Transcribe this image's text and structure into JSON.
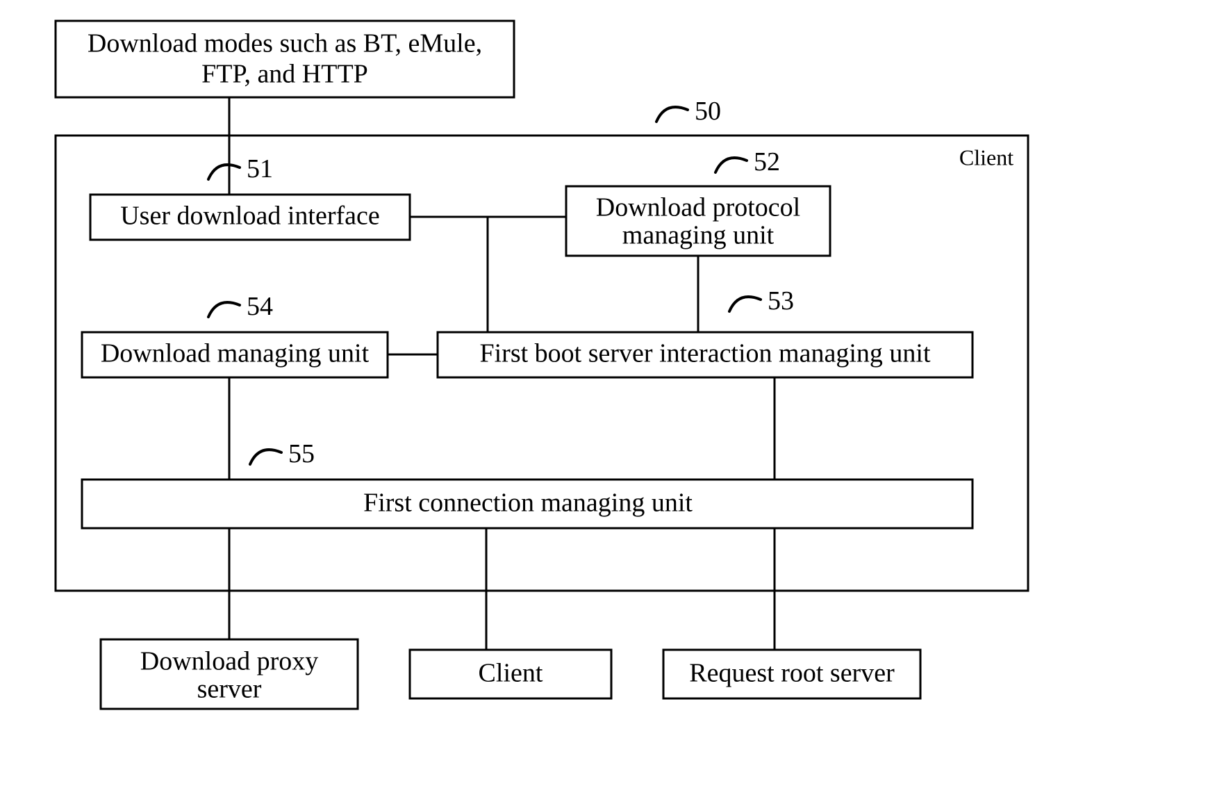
{
  "top": {
    "download_modes_l1": "Download modes such as BT, eMule,",
    "download_modes_l2": "FTP, and HTTP"
  },
  "container": {
    "title": "Client",
    "ref": "50"
  },
  "blocks": {
    "b51": {
      "ref": "51",
      "text": "User download interface"
    },
    "b52": {
      "ref": "52",
      "text_l1": "Download protocol",
      "text_l2": "managing unit"
    },
    "b53": {
      "ref": "53",
      "text": "First boot server interaction managing unit"
    },
    "b54": {
      "ref": "54",
      "text": "Download managing unit"
    },
    "b55": {
      "ref": "55",
      "text": "First connection managing unit"
    }
  },
  "bottom": {
    "proxy_l1": "Download proxy",
    "proxy_l2": "server",
    "client": "Client",
    "root": "Request root server"
  }
}
